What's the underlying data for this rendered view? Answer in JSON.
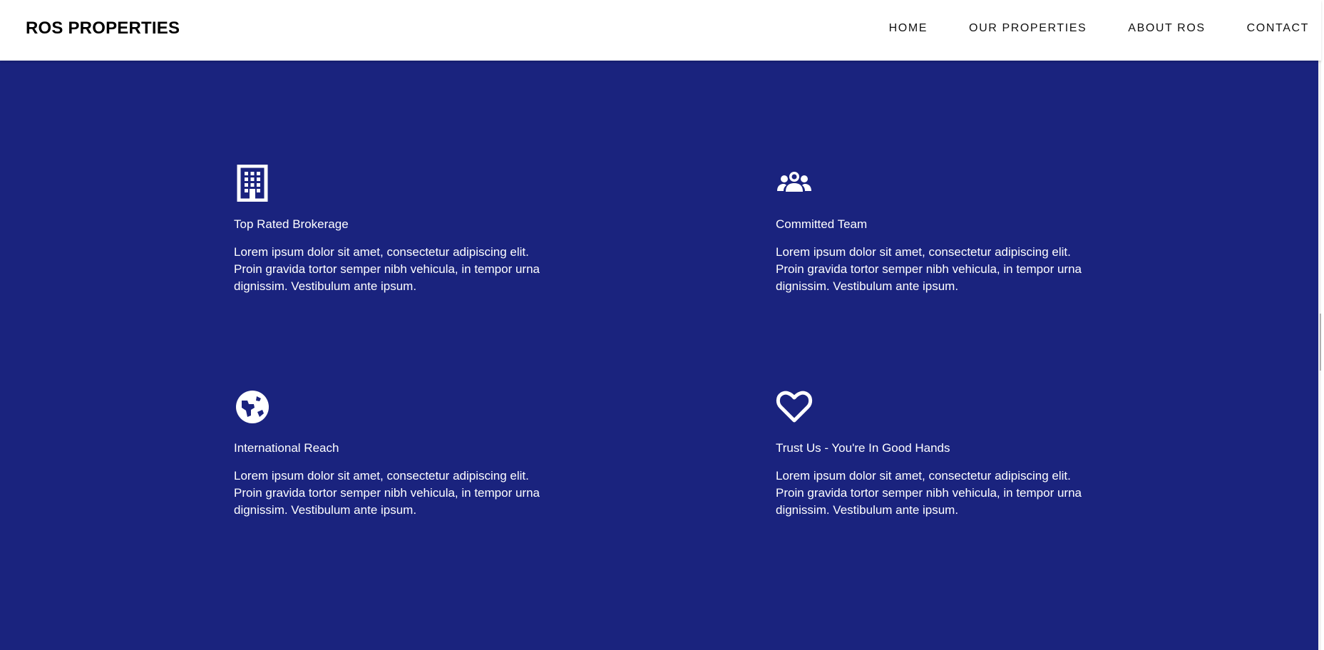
{
  "header": {
    "logo": "ROS PROPERTIES",
    "nav": [
      {
        "label": "HOME"
      },
      {
        "label": "OUR PROPERTIES"
      },
      {
        "label": "ABOUT ROS"
      },
      {
        "label": "CONTACT"
      }
    ]
  },
  "colors": {
    "main_background": "#1a237e",
    "header_background": "#ffffff",
    "text_on_main": "#ffffff"
  },
  "features": [
    {
      "icon": "building-icon",
      "title": "Top Rated Brokerage",
      "description": "Lorem ipsum dolor sit amet, consectetur adipiscing elit. Proin gravida tortor semper nibh vehicula, in tempor urna dignissim. Vestibulum ante ipsum."
    },
    {
      "icon": "team-icon",
      "title": "Committed Team",
      "description": "Lorem ipsum dolor sit amet, consectetur adipiscing elit. Proin gravida tortor semper nibh vehicula, in tempor urna dignissim. Vestibulum ante ipsum."
    },
    {
      "icon": "globe-icon",
      "title": "International Reach",
      "description": "Lorem ipsum dolor sit amet, consectetur adipiscing elit. Proin gravida tortor semper nibh vehicula, in tempor urna dignissim. Vestibulum ante ipsum."
    },
    {
      "icon": "heart-icon",
      "title": "Trust Us - You're In Good Hands",
      "description": "Lorem ipsum dolor sit amet, consectetur adipiscing elit. Proin gravida tortor semper nibh vehicula, in tempor urna dignissim. Vestibulum ante ipsum."
    }
  ]
}
